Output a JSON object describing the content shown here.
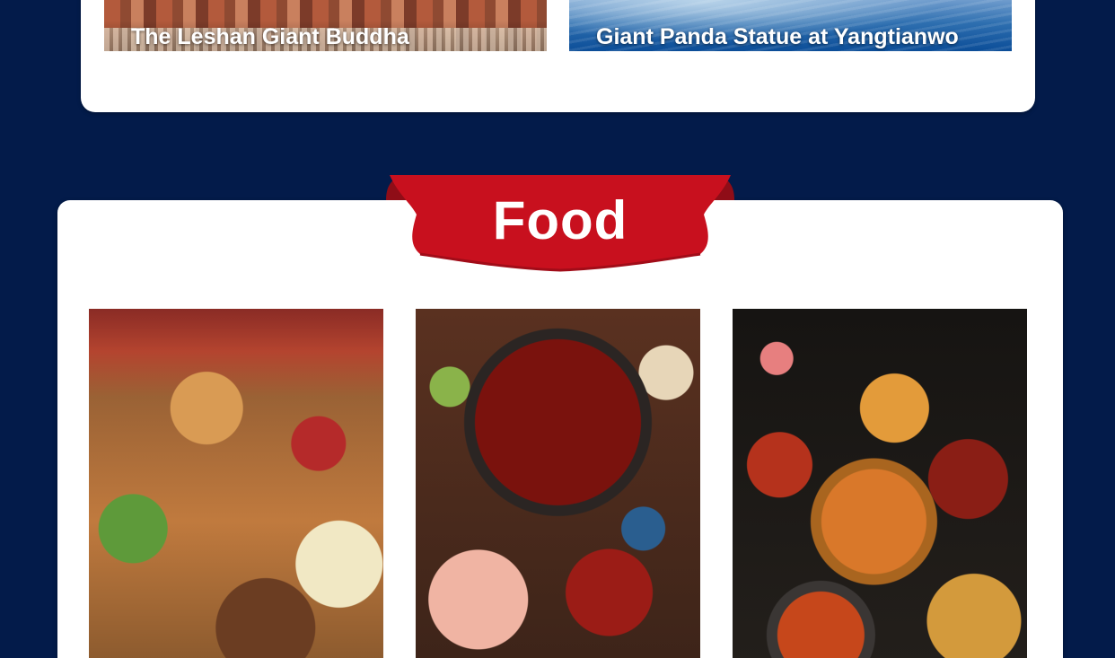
{
  "attractions": {
    "items": [
      {
        "label": "The Leshan Giant Buddha"
      },
      {
        "label": "Giant Panda Statue at Yangtianwo"
      }
    ]
  },
  "food": {
    "title": "Food",
    "banner_color": "#c8101e",
    "photos": [
      {
        "name": "copper-hotpot-photo"
      },
      {
        "name": "spicy-hotpot-photo"
      },
      {
        "name": "sichuan-dishes-photo"
      }
    ]
  },
  "colors": {
    "page_background": "#031b4a",
    "card_background": "#ffffff",
    "banner_red": "#c8101e"
  }
}
